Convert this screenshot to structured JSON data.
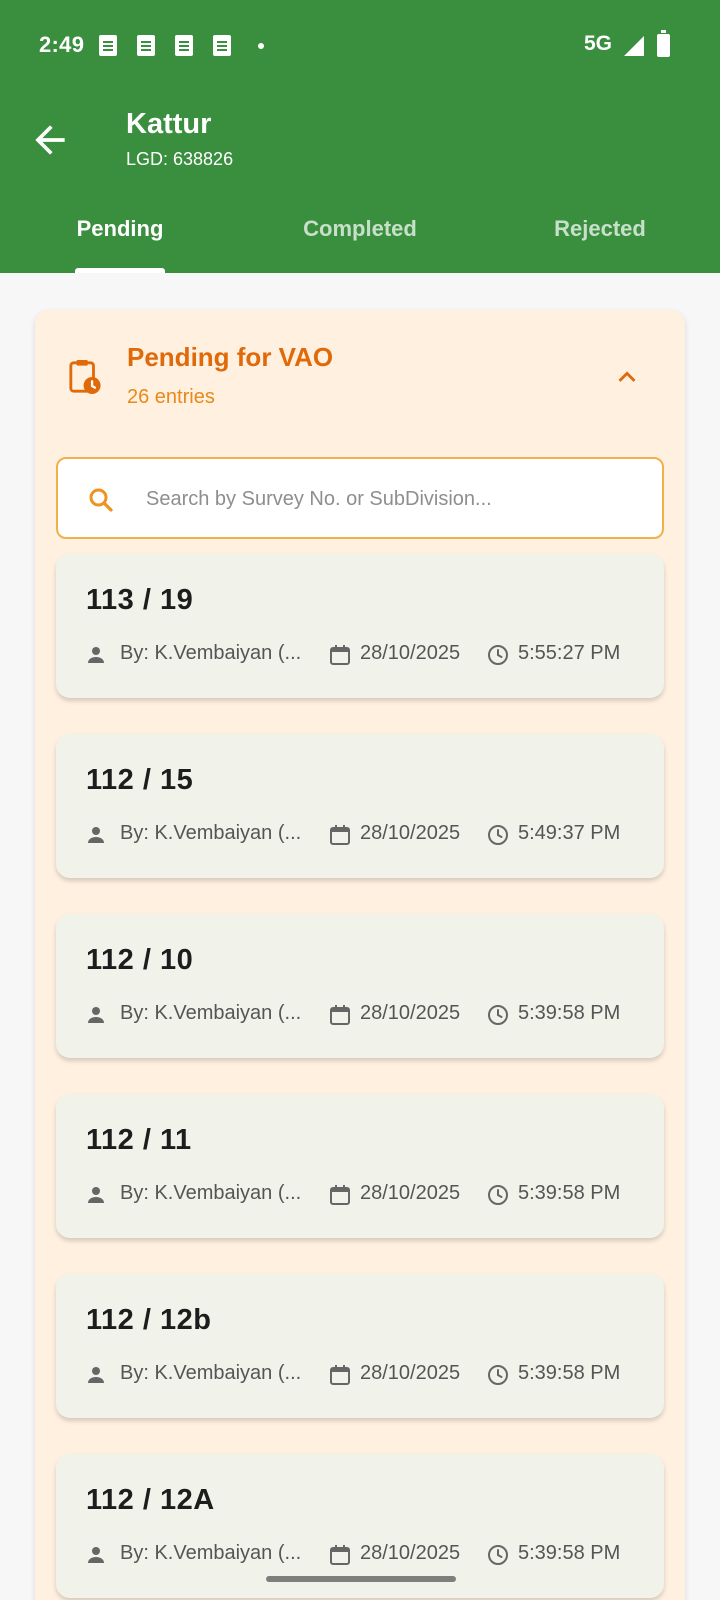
{
  "status_bar": {
    "time": "2:49",
    "network": "5G"
  },
  "header": {
    "title": "Kattur",
    "subtitle": "LGD: 638826"
  },
  "tabs": [
    {
      "label": "Pending",
      "active": true
    },
    {
      "label": "Completed",
      "active": false
    },
    {
      "label": "Rejected",
      "active": false
    }
  ],
  "panel": {
    "title": "Pending for VAO",
    "count": "26 entries",
    "search_placeholder": "Search by Survey No. or SubDivision..."
  },
  "entries": [
    {
      "survey": "113 / 19",
      "by": "By: K.Vembaiyan (...",
      "date": "28/10/2025",
      "time": "5:55:27 PM"
    },
    {
      "survey": "112 / 15",
      "by": "By: K.Vembaiyan (...",
      "date": "28/10/2025",
      "time": "5:49:37 PM"
    },
    {
      "survey": "112 / 10",
      "by": "By: K.Vembaiyan (...",
      "date": "28/10/2025",
      "time": "5:39:58 PM"
    },
    {
      "survey": "112 / 11",
      "by": "By: K.Vembaiyan (...",
      "date": "28/10/2025",
      "time": "5:39:58 PM"
    },
    {
      "survey": "112 / 12b",
      "by": "By: K.Vembaiyan (...",
      "date": "28/10/2025",
      "time": "5:39:58 PM"
    },
    {
      "survey": "112 / 12A",
      "by": "By: K.Vembaiyan (...",
      "date": "28/10/2025",
      "time": "5:39:58 PM"
    }
  ],
  "colors": {
    "appbar": "#3a8f3f",
    "accent_orange": "#e06a0a",
    "panel_bg": "#fff0df",
    "card_bg": "#f1f2ea"
  },
  "icons": [
    "arrow-back-icon",
    "clipboard-clock-icon",
    "chevron-up-icon",
    "search-icon",
    "person-icon",
    "calendar-icon",
    "clock-icon"
  ]
}
